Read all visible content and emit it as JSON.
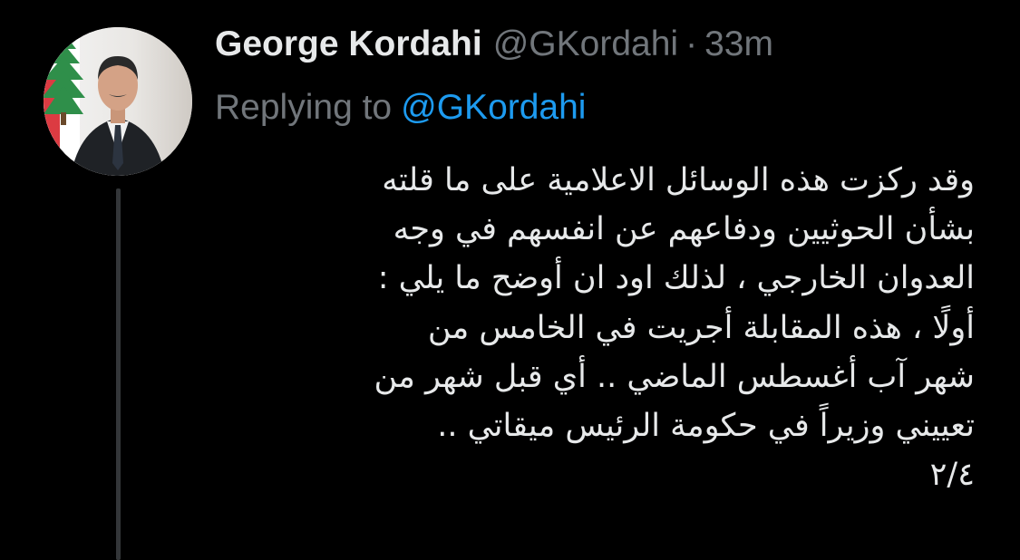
{
  "author": {
    "display_name": "George Kordahi",
    "handle": "@GKordahi",
    "separator": "·",
    "time": "33m"
  },
  "reply": {
    "prefix": "Replying to",
    "to_handle": "@GKordahi"
  },
  "tweet": {
    "lines": [
      "وقد ركزت هذه الوسائل الاعلامية على ما قلته",
      "بشأن الحوثيين ودفاعهم عن انفسهم في وجه",
      "العدوان الخارجي ، لذلك اود ان أوضح ما يلي :",
      "أولًا ، هذه المقابلة أجريت في الخامس من",
      "شهر آب أغسطس الماضي .. أي قبل شهر من",
      "تعييني وزيراً في حكومة الرئيس ميقاتي ..",
      "٢/٤"
    ]
  },
  "colors": {
    "background": "#000000",
    "primary_text": "#e7e9ea",
    "secondary_text": "#71767b",
    "link": "#1d9bf0",
    "thread_line": "#333639"
  },
  "icons": {
    "avatar": "profile-photo-with-lebanese-cedar-flag"
  }
}
